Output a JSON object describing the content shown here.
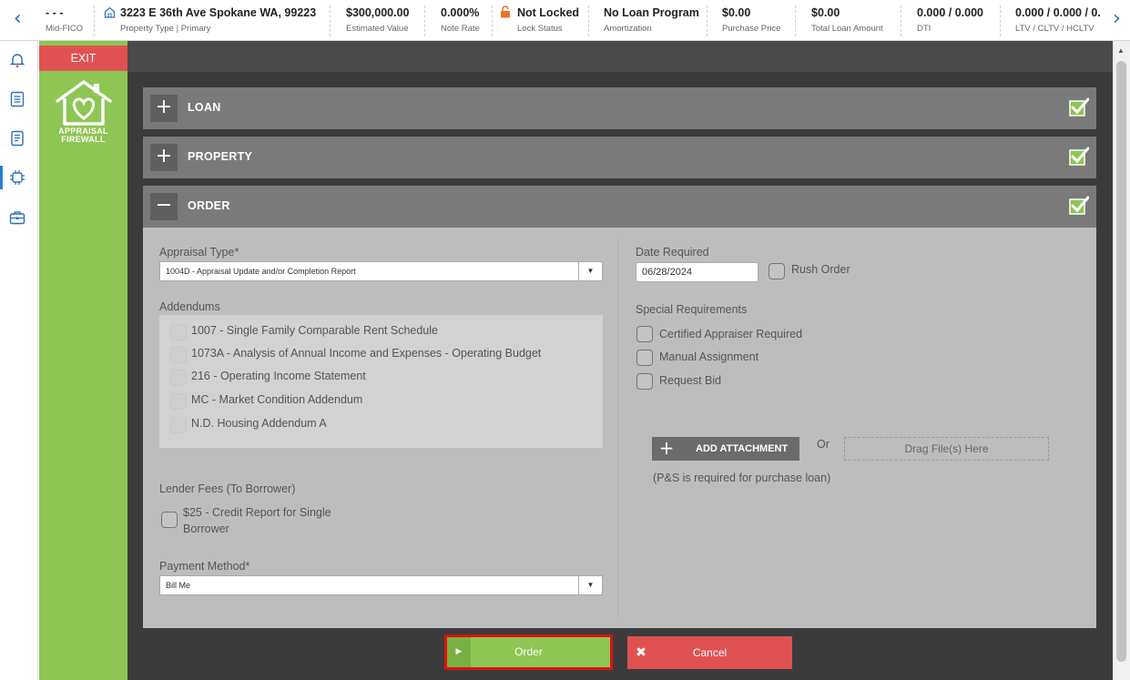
{
  "header": {
    "prev_arrow": "‹",
    "next_arrow": "›",
    "fico": {
      "value": "- - -",
      "label": "Mid-FICO"
    },
    "property": {
      "value": "3223 E 36th Ave Spokane WA, 99223",
      "label": "Property Type | Primary"
    },
    "estimated_value": {
      "value": "$300,000.00",
      "label": "Estimated Value"
    },
    "note_rate": {
      "value": "0.000%",
      "label": "Note Rate"
    },
    "lock_status": {
      "value": "Not Locked",
      "label": "Lock Status"
    },
    "amortization": {
      "value": "No Loan Program",
      "label": "Amortization"
    },
    "purchase_price": {
      "value": "$0.00",
      "label": "Purchase Price"
    },
    "total_loan_amount": {
      "value": "$0.00",
      "label": "Total Loan Amount"
    },
    "dti": {
      "value": "0.000 / 0.000",
      "label": "DTI"
    },
    "ltv": {
      "value": "0.000 / 0.000 / 0.",
      "label": "LTV / CLTV / HCLTV"
    }
  },
  "sidebar": {
    "exit_label": "EXIT",
    "logo_line1": "APPRAISAL",
    "logo_line2": "FIREWALL"
  },
  "sections": [
    {
      "title": "LOAN",
      "expanded": false,
      "complete": true
    },
    {
      "title": "PROPERTY",
      "expanded": false,
      "complete": true
    },
    {
      "title": "ORDER",
      "expanded": true,
      "complete": true
    }
  ],
  "order": {
    "appraisal_type_label": "Appraisal Type*",
    "appraisal_type_value": "1004D - Appraisal Update and/or Completion Report",
    "addendums_label": "Addendums",
    "addendums": [
      "1007 - Single Family Comparable Rent Schedule",
      "1073A - Analysis of Annual Income and Expenses - Operating Budget",
      "216 - Operating Income Statement",
      "MC - Market Condition Addendum",
      "N.D. Housing Addendum A"
    ],
    "lender_fees_label": "Lender Fees (To Borrower)",
    "lender_fee_line1": "$25 - Credit Report for Single",
    "lender_fee_line2": "Borrower",
    "payment_method_label": "Payment Method*",
    "payment_method_value": "Bill Me",
    "date_required_label": "Date Required",
    "date_required_value": "06/28/2024",
    "rush_order_label": "Rush Order",
    "special_requirements_label": "Special Requirements",
    "special_requirements": [
      "Certified Appraiser Required",
      "Manual Assignment",
      "Request Bid"
    ],
    "add_attachment_label": "ADD ATTACHMENT",
    "or_label": "Or",
    "drag_label": "Drag File(s) Here",
    "attachment_note": "(P&S is required for purchase loan)"
  },
  "actions": {
    "order_label": "Order",
    "cancel_label": "Cancel"
  },
  "colors": {
    "brand_green": "#8dc653",
    "danger_red": "#e05252",
    "accent_blue": "#2a6fb5"
  }
}
